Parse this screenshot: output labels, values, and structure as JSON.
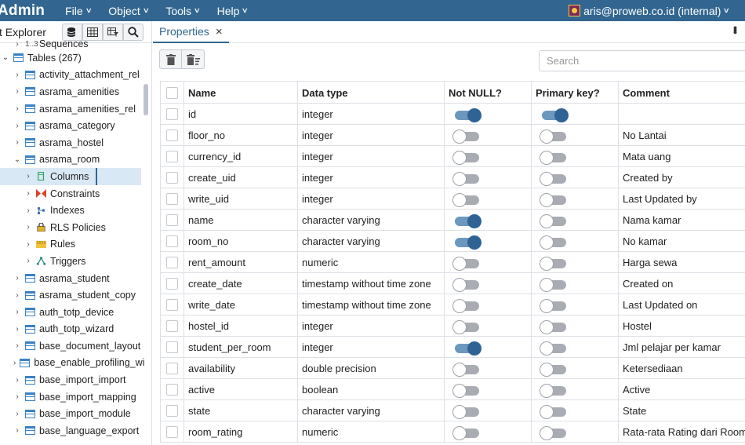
{
  "menubar": {
    "brand": "Admin",
    "menus": [
      "File",
      "Object",
      "Tools",
      "Help"
    ],
    "user": "aris@proweb.co.id (internal)"
  },
  "explorer": {
    "title": "t Explorer",
    "tree": [
      {
        "label": "Sequences",
        "caret": "›",
        "indent": 1,
        "icon": "sequence-icon"
      },
      {
        "label": "Tables (267)",
        "caret": "⌄",
        "indent": 0,
        "icon": "tables-icon"
      },
      {
        "label": "activity_attachment_rel",
        "caret": "›",
        "indent": 1,
        "icon": "table-icon"
      },
      {
        "label": "asrama_amenities",
        "caret": "›",
        "indent": 1,
        "icon": "table-icon"
      },
      {
        "label": "asrama_amenities_rel",
        "caret": "›",
        "indent": 1,
        "icon": "table-icon"
      },
      {
        "label": "asrama_category",
        "caret": "›",
        "indent": 1,
        "icon": "table-icon"
      },
      {
        "label": "asrama_hostel",
        "caret": "›",
        "indent": 1,
        "icon": "table-icon"
      },
      {
        "label": "asrama_room",
        "caret": "⌄",
        "indent": 1,
        "icon": "table-icon"
      },
      {
        "label": "Columns",
        "caret": "›",
        "indent": 2,
        "icon": "columns-icon",
        "selected": true
      },
      {
        "label": "Constraints",
        "caret": "›",
        "indent": 2,
        "icon": "constraints-icon"
      },
      {
        "label": "Indexes",
        "caret": "›",
        "indent": 2,
        "icon": "indexes-icon"
      },
      {
        "label": "RLS Policies",
        "caret": "›",
        "indent": 2,
        "icon": "rls-policies-icon"
      },
      {
        "label": "Rules",
        "caret": "›",
        "indent": 2,
        "icon": "rules-icon"
      },
      {
        "label": "Triggers",
        "caret": "›",
        "indent": 2,
        "icon": "triggers-icon"
      },
      {
        "label": "asrama_student",
        "caret": "›",
        "indent": 1,
        "icon": "table-icon"
      },
      {
        "label": "asrama_student_copy",
        "caret": "›",
        "indent": 1,
        "icon": "table-icon"
      },
      {
        "label": "auth_totp_device",
        "caret": "›",
        "indent": 1,
        "icon": "table-icon"
      },
      {
        "label": "auth_totp_wizard",
        "caret": "›",
        "indent": 1,
        "icon": "table-icon"
      },
      {
        "label": "base_document_layout",
        "caret": "›",
        "indent": 1,
        "icon": "table-icon"
      },
      {
        "label": "base_enable_profiling_wi",
        "caret": "›",
        "indent": 1,
        "icon": "table-icon"
      },
      {
        "label": "base_import_import",
        "caret": "›",
        "indent": 1,
        "icon": "table-icon"
      },
      {
        "label": "base_import_mapping",
        "caret": "›",
        "indent": 1,
        "icon": "table-icon"
      },
      {
        "label": "base_import_module",
        "caret": "›",
        "indent": 1,
        "icon": "table-icon"
      },
      {
        "label": "base_language_export",
        "caret": "›",
        "indent": 1,
        "icon": "table-icon"
      }
    ]
  },
  "tab": {
    "label": "Properties",
    "close": "×"
  },
  "search": {
    "placeholder": "Search"
  },
  "grid": {
    "headers": [
      "Name",
      "Data type",
      "Not NULL?",
      "Primary key?",
      "Comment"
    ],
    "rows": [
      {
        "name": "id",
        "type": "integer",
        "notnull": true,
        "pk": true,
        "comment": ""
      },
      {
        "name": "floor_no",
        "type": "integer",
        "notnull": false,
        "pk": false,
        "comment": "No Lantai"
      },
      {
        "name": "currency_id",
        "type": "integer",
        "notnull": false,
        "pk": false,
        "comment": "Mata uang"
      },
      {
        "name": "create_uid",
        "type": "integer",
        "notnull": false,
        "pk": false,
        "comment": "Created by"
      },
      {
        "name": "write_uid",
        "type": "integer",
        "notnull": false,
        "pk": false,
        "comment": "Last Updated by"
      },
      {
        "name": "name",
        "type": "character varying",
        "notnull": true,
        "pk": false,
        "comment": "Nama kamar"
      },
      {
        "name": "room_no",
        "type": "character varying",
        "notnull": true,
        "pk": false,
        "comment": "No kamar"
      },
      {
        "name": "rent_amount",
        "type": "numeric",
        "notnull": false,
        "pk": false,
        "comment": "Harga sewa"
      },
      {
        "name": "create_date",
        "type": "timestamp without time zone",
        "notnull": false,
        "pk": false,
        "comment": "Created on"
      },
      {
        "name": "write_date",
        "type": "timestamp without time zone",
        "notnull": false,
        "pk": false,
        "comment": "Last Updated on"
      },
      {
        "name": "hostel_id",
        "type": "integer",
        "notnull": false,
        "pk": false,
        "comment": "Hostel"
      },
      {
        "name": "student_per_room",
        "type": "integer",
        "notnull": true,
        "pk": false,
        "comment": "Jml pelajar per kamar"
      },
      {
        "name": "availability",
        "type": "double precision",
        "notnull": false,
        "pk": false,
        "comment": "Ketersediaan"
      },
      {
        "name": "active",
        "type": "boolean",
        "notnull": false,
        "pk": false,
        "comment": "Active"
      },
      {
        "name": "state",
        "type": "character varying",
        "notnull": false,
        "pk": false,
        "comment": "State"
      },
      {
        "name": "room_rating",
        "type": "numeric",
        "notnull": false,
        "pk": false,
        "comment": "Rata-rata Rating dari Room"
      }
    ]
  }
}
